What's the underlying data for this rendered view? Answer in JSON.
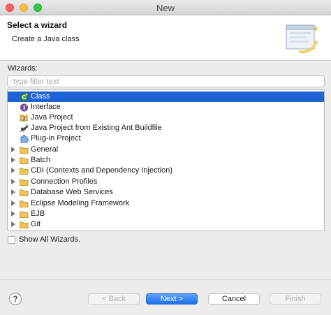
{
  "window": {
    "title": "New"
  },
  "header": {
    "title": "Select a wizard",
    "subtitle": "Create a Java class"
  },
  "wizards": {
    "label": "Wizards:",
    "filter_placeholder": "type filter text",
    "items": [
      {
        "label": "Class",
        "icon": "java-class-icon",
        "selected": true
      },
      {
        "label": "Interface",
        "icon": "java-interface-icon"
      },
      {
        "label": "Java Project",
        "icon": "java-project-icon"
      },
      {
        "label": "Java Project from Existing Ant Buildfile",
        "icon": "ant-project-icon"
      },
      {
        "label": "Plug-in Project",
        "icon": "plugin-project-icon"
      },
      {
        "label": "General",
        "icon": "folder-icon"
      },
      {
        "label": "Batch",
        "icon": "folder-icon"
      },
      {
        "label": "CDI (Contexts and Dependency Injection)",
        "icon": "folder-icon"
      },
      {
        "label": "Connection Profiles",
        "icon": "folder-icon"
      },
      {
        "label": "Database Web Services",
        "icon": "folder-icon"
      },
      {
        "label": "Eclipse Modeling Framework",
        "icon": "folder-icon"
      },
      {
        "label": "EJB",
        "icon": "folder-icon"
      },
      {
        "label": "Git",
        "icon": "folder-icon"
      }
    ]
  },
  "show_all": {
    "label": "Show All Wizards."
  },
  "buttons": {
    "help": "?",
    "back": "< Back",
    "next": "Next >",
    "cancel": "Cancel",
    "finish": "Finish"
  },
  "colors": {
    "selection": "#1d63d4",
    "primary_button": "#2f7ff0",
    "folder": "#f0c45a"
  }
}
